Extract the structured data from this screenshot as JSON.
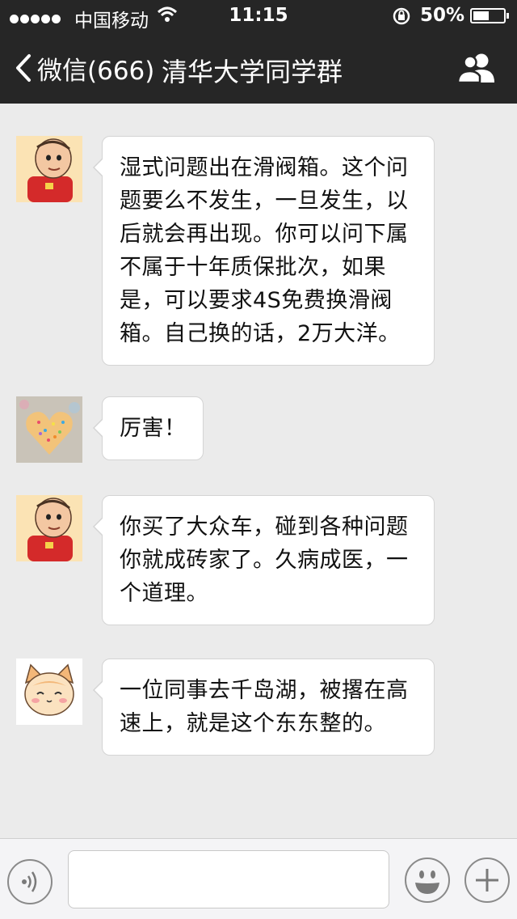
{
  "status_bar": {
    "carrier": "中国移动",
    "time": "11:15",
    "battery_percent": "50%",
    "battery_level": 0.5
  },
  "nav": {
    "back_label": "微信(666)",
    "title": "清华大学同学群"
  },
  "messages": [
    {
      "avatar": "cartoon-man-avatar",
      "text": "湿式问题出在滑阀箱。这个问题要么不发生，一旦发生，以后就会再出现。你可以问下属不属于十年质保批次，如果是，可以要求4S免费换滑阀箱。自己换的话，2万大洋。"
    },
    {
      "avatar": "heart-cookie-avatar",
      "text": "厉害！"
    },
    {
      "avatar": "cartoon-man-avatar",
      "text": "你买了大众车，碰到各种问题你就成砖家了。久病成医，一个道理。"
    },
    {
      "avatar": "cartoon-cat-avatar",
      "text": "一位同事去千岛湖，被撂在高速上，就是这个东东整的。"
    }
  ],
  "input_bar": {
    "text_value": "",
    "icons": [
      "voice-icon",
      "emoji-icon",
      "plus-icon"
    ]
  },
  "colors": {
    "nav_background": "#262626",
    "chat_background": "#ebebeb",
    "bubble_background": "#ffffff"
  }
}
